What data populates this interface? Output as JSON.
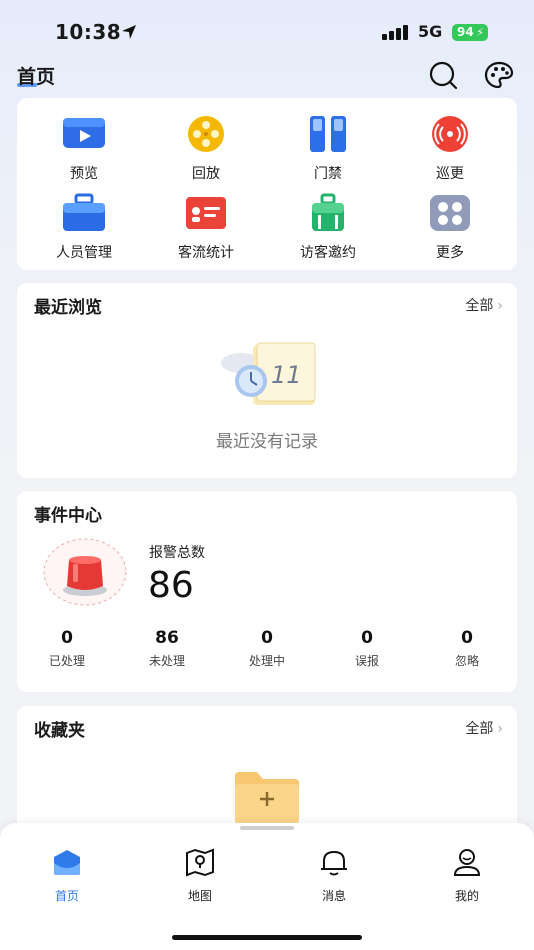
{
  "status_bar": {
    "time": "10:38",
    "network": "5G",
    "battery": "94"
  },
  "header": {
    "title": "首页",
    "icons": [
      "search-icon",
      "palette-icon"
    ]
  },
  "quick_grid": {
    "items": [
      {
        "label": "预览",
        "icon": "video-preview-icon"
      },
      {
        "label": "回放",
        "icon": "film-reel-icon"
      },
      {
        "label": "门禁",
        "icon": "door-access-icon"
      },
      {
        "label": "巡更",
        "icon": "patrol-signal-icon"
      },
      {
        "label": "人员管理",
        "icon": "personnel-briefcase-icon"
      },
      {
        "label": "客流统计",
        "icon": "visitor-flow-card-icon"
      },
      {
        "label": "访客邀约",
        "icon": "visitor-luggage-icon"
      },
      {
        "label": "更多",
        "icon": "more-grid-icon"
      }
    ]
  },
  "recent": {
    "title": "最近浏览",
    "more_label": "全部",
    "empty_text": "最近没有记录",
    "illustration_day": "11"
  },
  "events": {
    "title": "事件中心",
    "alarm_label": "报警总数",
    "alarm_total": "86",
    "stats": [
      {
        "value": "0",
        "label": "已处理"
      },
      {
        "value": "86",
        "label": "未处理"
      },
      {
        "value": "0",
        "label": "处理中"
      },
      {
        "value": "0",
        "label": "误报"
      },
      {
        "value": "0",
        "label": "忽略"
      }
    ]
  },
  "favorites": {
    "title": "收藏夹",
    "more_label": "全部"
  },
  "tabbar": {
    "tabs": [
      {
        "label": "首页",
        "icon": "home-icon",
        "active": true
      },
      {
        "label": "地图",
        "icon": "map-icon",
        "active": false
      },
      {
        "label": "消息",
        "icon": "bell-icon",
        "active": false
      },
      {
        "label": "我的",
        "icon": "profile-icon",
        "active": false
      }
    ]
  },
  "colors": {
    "accent": "#2f7bea",
    "alarm_red": "#e53935",
    "battery_green": "#34c759"
  }
}
